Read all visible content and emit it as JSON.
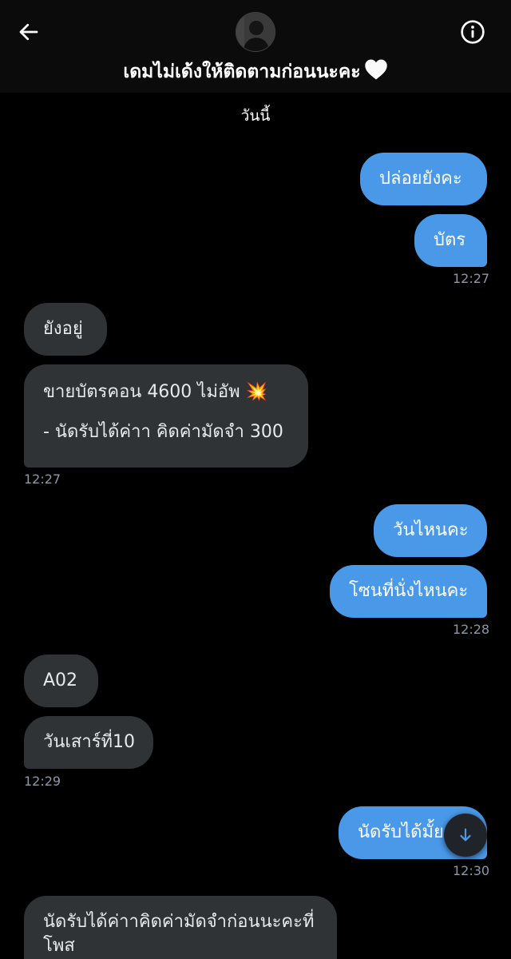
{
  "header": {
    "title": "เดมไม่เด้งให้ติดตามก่อนนะคะ",
    "heart_emoji": "🤍",
    "back_icon": "arrow-left-icon",
    "info_icon": "info-circle-icon"
  },
  "date_separator": "วันนี้",
  "messages": [
    {
      "dir": "out",
      "text": "ปล่อยยังคะ"
    },
    {
      "dir": "out",
      "text": "บัตร"
    },
    {
      "dir": "out",
      "time": "12:27"
    },
    {
      "dir": "in",
      "text": "ยังอยู่"
    },
    {
      "dir": "in",
      "line1": "ขายบัตรคอน 4600 ไม่อัพ 💥",
      "line2": "- นัดรับได้ค่าา คิดค่ามัดจำ 300"
    },
    {
      "dir": "in",
      "time": "12:27"
    },
    {
      "dir": "out",
      "text": "วันไหนคะ"
    },
    {
      "dir": "out",
      "text": "โซนที่นั่งไหนคะ"
    },
    {
      "dir": "out",
      "time": "12:28"
    },
    {
      "dir": "in",
      "text": "A02"
    },
    {
      "dir": "in",
      "text": "วันเสาร์ที่10"
    },
    {
      "dir": "in",
      "time": "12:29"
    },
    {
      "dir": "out",
      "text": "นัดรับได้มั้ยคะ"
    },
    {
      "dir": "out",
      "time": "12:30"
    },
    {
      "dir": "in",
      "text": "นัดรับได้ค่าาคิดค่ามัดจำก่อนนะคะที่โพส"
    }
  ],
  "colors": {
    "background": "#000000",
    "outgoing_bubble": "#4a99e9",
    "incoming_bubble": "#2f3336",
    "timestamp": "#8b98a5"
  },
  "scroll_button_icon": "arrow-down-icon"
}
